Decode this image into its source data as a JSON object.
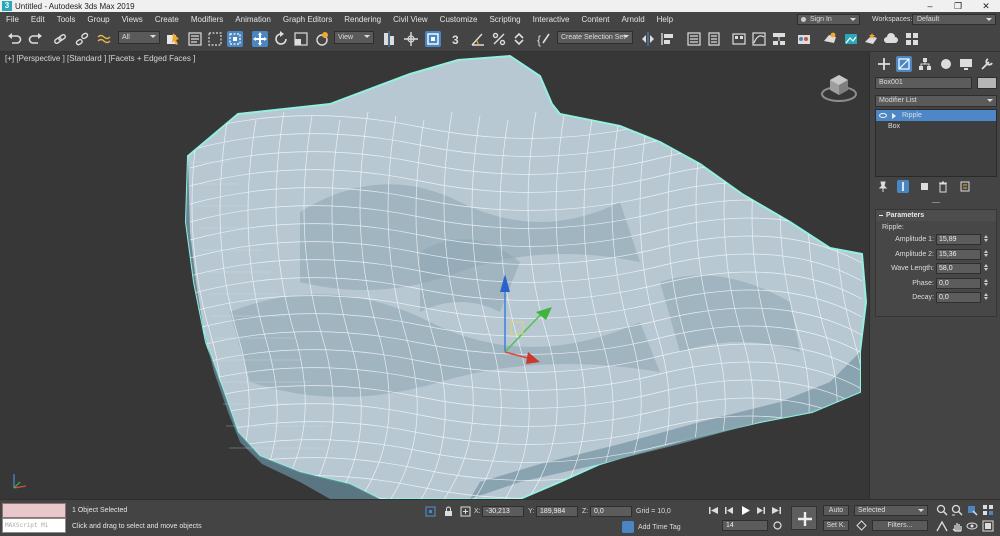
{
  "window": {
    "title": "Untitled - Autodesk 3ds Max 2019",
    "app_icon": "3"
  },
  "menu": [
    "File",
    "Edit",
    "Tools",
    "Group",
    "Views",
    "Create",
    "Modifiers",
    "Animation",
    "Graph Editors",
    "Rendering",
    "Civil View",
    "Customize",
    "Scripting",
    "Interactive",
    "Content",
    "Arnold",
    "Help"
  ],
  "account": {
    "signin": "Sign In",
    "workspaces_label": "Workspaces:",
    "workspace": "Default"
  },
  "toolbar": {
    "filter": "All",
    "ref_coord": "View",
    "snap_label": "3",
    "selection_set": "Create Selection Set"
  },
  "viewport": {
    "label": "[+] [Perspective ] [Standard ] [Facets + Edged Faces ]"
  },
  "command_panel": {
    "object_name": "Box001",
    "modifier_list": "Modifier List",
    "stack": [
      {
        "label": "Ripple",
        "selected": true
      },
      {
        "label": "Box",
        "selected": false
      }
    ],
    "rollout_title": "Parameters",
    "group_label": "Ripple:",
    "params": [
      {
        "label": "Amplitude 1:",
        "value": "15,89"
      },
      {
        "label": "Amplitude 2:",
        "value": "15,36"
      },
      {
        "label": "Wave Length:",
        "value": "58,0"
      },
      {
        "label": "Phase:",
        "value": "0,0"
      },
      {
        "label": "Decay:",
        "value": "0,0"
      }
    ]
  },
  "status": {
    "maxscript": "MAXScript Mi",
    "selection": "1 Object Selected",
    "prompt": "Click and drag to select and move objects",
    "x_label": "X:",
    "x": "-30,213",
    "y_label": "Y:",
    "y": "189,984",
    "z_label": "Z:",
    "z": "0,0",
    "grid": "Grid = 10,0",
    "add_time_tag": "Add Time Tag",
    "frame": "14",
    "auto": "Auto",
    "setk": "Set K.",
    "selected": "Selected",
    "filters": "Filters..."
  }
}
